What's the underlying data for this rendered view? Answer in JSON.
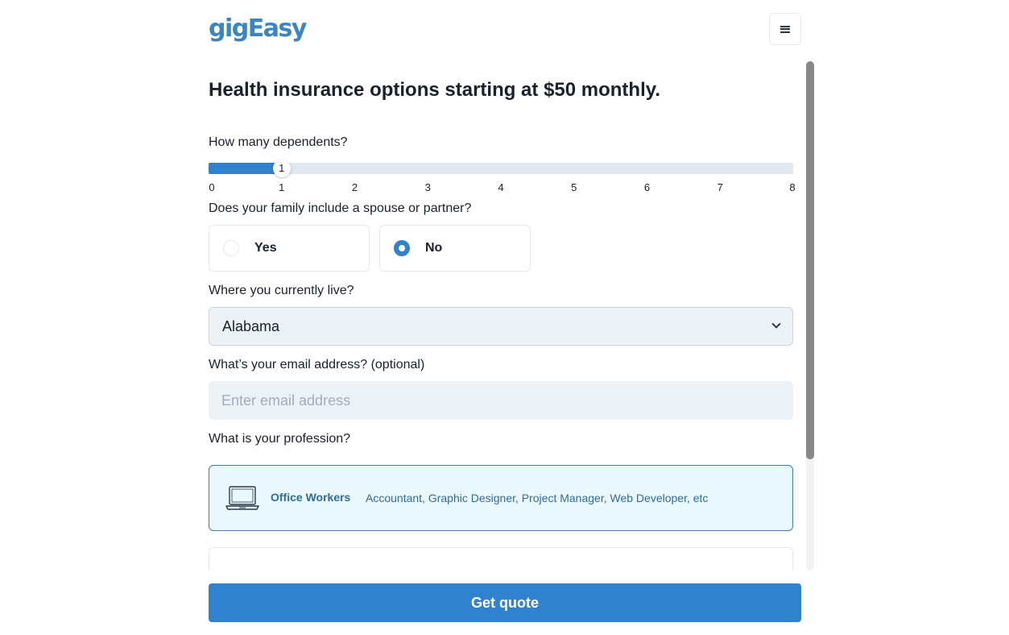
{
  "header": {
    "logo_text": "gigEasy",
    "menu_icon": "hamburger-icon"
  },
  "form": {
    "title": "Health insurance options starting at $50 monthly.",
    "dependents": {
      "label": "How many dependents?",
      "min": 0,
      "max": 8,
      "value": 1,
      "value_label": "1",
      "ticks": [
        "0",
        "1",
        "2",
        "3",
        "4",
        "5",
        "6",
        "7",
        "8"
      ]
    },
    "spouse": {
      "label": "Does your family include a spouse or partner?",
      "options": [
        {
          "label": "Yes",
          "checked": false
        },
        {
          "label": "No",
          "checked": true
        }
      ]
    },
    "location": {
      "label": "Where you currently live?",
      "selected": "Alabama",
      "icon": "chevron-down-icon"
    },
    "email": {
      "label": "What’s your email address? (optional)",
      "placeholder": "Enter email address",
      "value": ""
    },
    "profession": {
      "label": "What is your profession?",
      "options": [
        {
          "icon": "laptop-icon",
          "name": "Office Workers",
          "description": "Accountant, Graphic Designer, Project Manager, Web Developer, etc",
          "selected": true
        },
        {
          "icon": "helmet-icon",
          "selected": false
        }
      ]
    }
  },
  "footer": {
    "cta_label": "Get quote"
  },
  "colors": {
    "brand": "#3a86c2",
    "primary": "#3182ce",
    "selected_card_bg": "#ebf8ff",
    "input_bg": "#edf2f7"
  }
}
